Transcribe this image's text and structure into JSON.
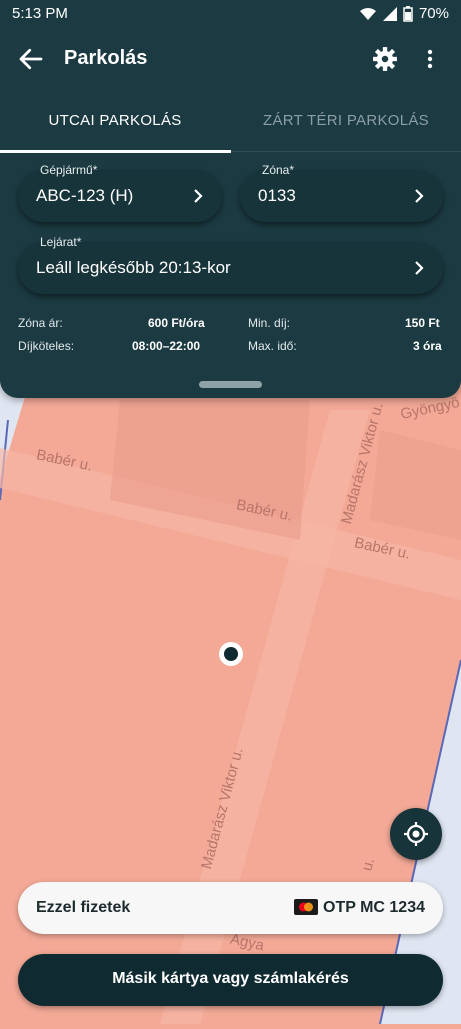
{
  "status": {
    "time": "5:13 PM",
    "battery": "70%"
  },
  "appbar": {
    "title": "Parkolás"
  },
  "tabs": [
    {
      "label": "UTCAI PARKOLÁS"
    },
    {
      "label": "ZÁRT TÉRI PARKOLÁS"
    }
  ],
  "fields": {
    "vehicle": {
      "label": "Gépjármű*",
      "value": "ABC-123 (H)"
    },
    "zone": {
      "label": "Zóna*",
      "value": "0133"
    },
    "expiry": {
      "label": "Lejárat*",
      "value": "Leáll legkésőbb 20:13-kor"
    }
  },
  "info": {
    "zone_price_label": "Zóna ár:",
    "zone_price": "600 Ft/óra",
    "min_fee_label": "Min. díj:",
    "min_fee": "150 Ft",
    "paid_hours_label": "Díjköteles:",
    "paid_hours": "08:00–22:00",
    "max_time_label": "Max. idő:",
    "max_time": "3 óra"
  },
  "map": {
    "streets": [
      "Babér u.",
      "Babér u.",
      "Babér u.",
      "Madarász Viktor u.",
      "Madarász Viktor u.",
      "Gyöngyö",
      "u.",
      "Agya"
    ]
  },
  "payment": {
    "label": "Ezzel fizetek",
    "card": "OTP MC 1234"
  },
  "cta": {
    "label": "Másik kártya vagy számlakérés"
  },
  "colors": {
    "header": "#1b3a41",
    "zone_fill": "#f3a996",
    "button": "#0f2a31"
  }
}
